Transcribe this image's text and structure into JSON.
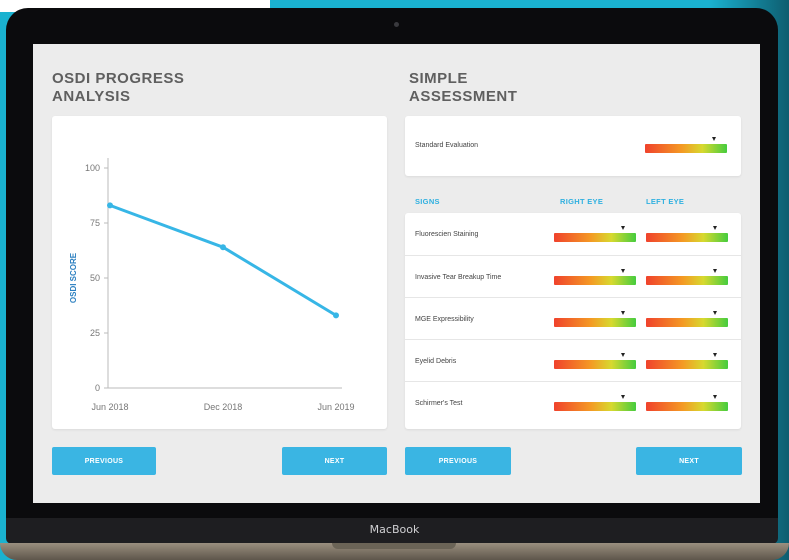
{
  "brand": "MacBook",
  "left_panel": {
    "title_line1": "OSDI PROGRESS",
    "title_line2": "ANALYSIS",
    "previous_label": "PREVIOUS",
    "next_label": "NEXT"
  },
  "right_panel": {
    "title_line1": "SIMPLE",
    "title_line2": "ASSESSMENT",
    "standard_evaluation": {
      "label": "Standard Evaluation",
      "level": 0.85
    },
    "headers": {
      "signs": "SIGNS",
      "right_eye": "RIGHT EYE",
      "left_eye": "LEFT EYE"
    },
    "rows": [
      {
        "label": "Fluorescien Staining",
        "right_level": 0.85,
        "left_level": 0.85
      },
      {
        "label": "Invasive Tear Breakup Time",
        "right_level": 0.85,
        "left_level": 0.85
      },
      {
        "label": "MGE Expressibility",
        "right_level": 0.85,
        "left_level": 0.85
      },
      {
        "label": "Eyelid Debris",
        "right_level": 0.85,
        "left_level": 0.85
      },
      {
        "label": "Schirmer's Test",
        "right_level": 0.85,
        "left_level": 0.85
      }
    ],
    "previous_label": "PREVIOUS",
    "next_label": "NEXT"
  },
  "chart_data": {
    "type": "line",
    "x": [
      "Jun 2018",
      "Dec 2018",
      "Jun 2019"
    ],
    "x_positions": [
      0.0,
      0.5,
      1.0
    ],
    "series": [
      {
        "values": [
          83,
          64,
          33
        ],
        "color": "#37b6e6"
      }
    ],
    "points_x": [
      0.0,
      0.5,
      1.0
    ],
    "y_ticks": [
      "100",
      "75",
      "50",
      "25",
      "0"
    ],
    "ylim": [
      0,
      100
    ],
    "ylabel": "OSDI SCORE",
    "xlabel": "",
    "grid": false
  }
}
